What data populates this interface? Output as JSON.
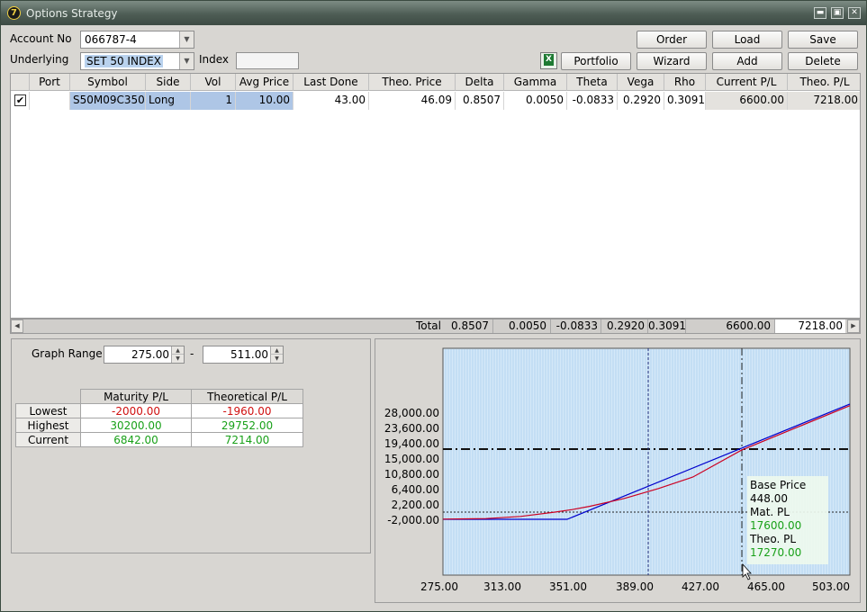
{
  "window": {
    "title": "Options Strategy"
  },
  "account": {
    "label": "Account No",
    "value": "066787-4"
  },
  "underlying": {
    "label": "Underlying",
    "value": "SET 50 INDEX"
  },
  "index": {
    "label": "Index",
    "value": ""
  },
  "buttons": {
    "order": "Order",
    "load": "Load",
    "save": "Save",
    "portfolio": "Portfolio",
    "wizard": "Wizard",
    "add": "Add",
    "delete": "Delete"
  },
  "grid": {
    "columns": [
      "",
      "Port",
      "Symbol",
      "Side",
      "Vol",
      "Avg Price",
      "Last Done",
      "Theo. Price",
      "Delta",
      "Gamma",
      "Theta",
      "Vega",
      "Rho",
      "Current P/L",
      "Theo. P/L"
    ],
    "rows": [
      {
        "checked": "✔",
        "port": "",
        "symbol": "S50M09C350",
        "side": "Long",
        "vol": "1",
        "avg_price": "10.00",
        "last_done": "43.00",
        "theo_price": "46.09",
        "delta": "0.8507",
        "gamma": "0.0050",
        "theta": "-0.0833",
        "vega": "0.2920",
        "rho": "0.3091",
        "current_pl": "6600.00",
        "theo_pl": "7218.00"
      }
    ],
    "total": {
      "label": "Total",
      "delta": "0.8507",
      "gamma": "0.0050",
      "theta": "-0.0833",
      "vega": "0.2920",
      "rho": "0.3091",
      "current_pl": "6600.00",
      "theo_pl": "7218.00"
    }
  },
  "graph_range": {
    "label": "Graph Range",
    "from": "275.00",
    "sep": "-",
    "to": "511.00"
  },
  "pl_table": {
    "headers": [
      "Maturity P/L",
      "Theoretical P/L"
    ],
    "rows": [
      {
        "label": "Lowest",
        "maturity": "-2000.00",
        "theoretical": "-1960.00"
      },
      {
        "label": "Highest",
        "maturity": "30200.00",
        "theoretical": "29752.00"
      },
      {
        "label": "Current",
        "maturity": "6842.00",
        "theoretical": "7214.00"
      }
    ]
  },
  "tooltip": {
    "base_label": "Base Price",
    "base_value": "448.00",
    "mat_label": "Mat. PL",
    "mat_value": "17600.00",
    "theo_label": "Theo. PL",
    "theo_value": "17270.00"
  },
  "colors": {
    "maturity_line": "#0000cc",
    "theoretical_line": "#cc0022",
    "plot_bg": "#d4e8f8",
    "profit": "#18a018",
    "loss": "#d01010"
  },
  "chart_data": {
    "type": "line",
    "title": "",
    "xlabel": "",
    "ylabel": "",
    "x_ticks": [
      "275.00",
      "313.00",
      "351.00",
      "389.00",
      "427.00",
      "465.00",
      "503.00"
    ],
    "y_ticks": [
      "28,000.00",
      "23,600.00",
      "19,400.00",
      "15,000.00",
      "10,800.00",
      "6,400.00",
      "2,200.00",
      "-2,000.00"
    ],
    "xlim": [
      275,
      511
    ],
    "ylim": [
      -8000,
      36000
    ],
    "series": [
      {
        "x": [
          275,
          347,
          511
        ],
        "y": [
          -2000,
          -2000,
          30200
        ]
      },
      {
        "x": [
          275,
          300,
          320,
          340,
          350,
          360,
          380,
          400,
          420,
          448,
          480,
          511
        ],
        "y": [
          -1960,
          -1800,
          -1200,
          0,
          700,
          1600,
          3800,
          6600,
          9800,
          17270,
          23600,
          29752
        ]
      }
    ],
    "base_price": 448,
    "current_price": 390,
    "current_pl_line": 17600,
    "zero_line": 0,
    "grid": true,
    "legend": "none"
  }
}
